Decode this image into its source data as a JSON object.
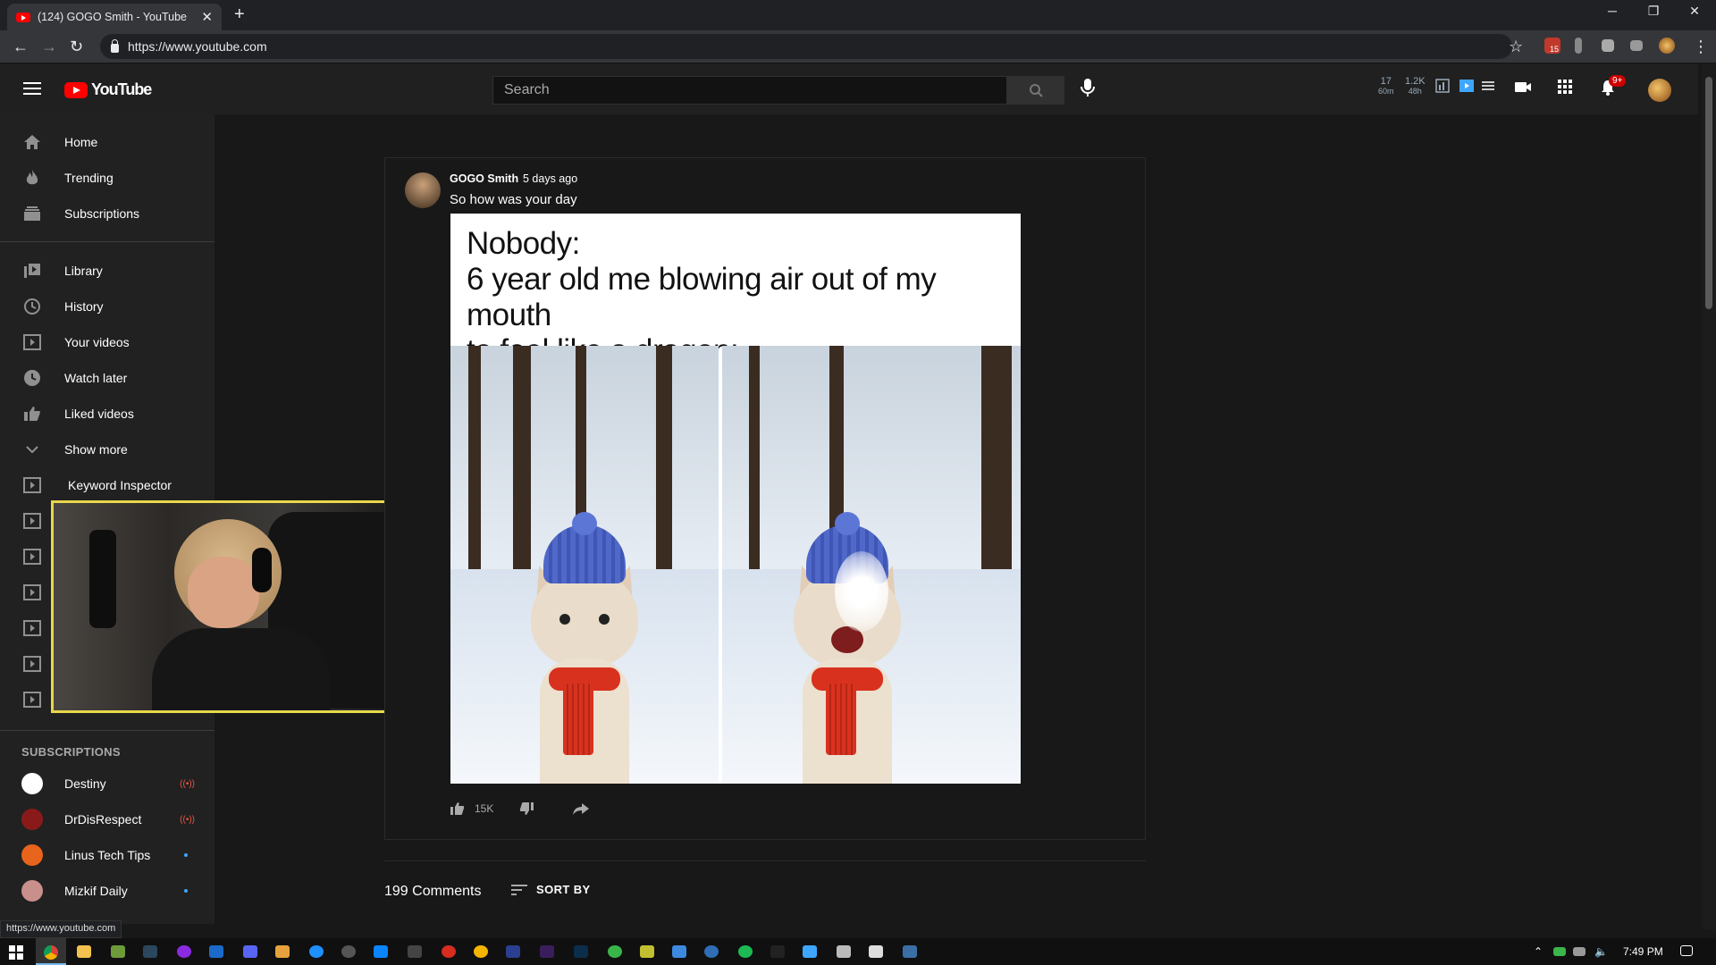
{
  "browser": {
    "tab_title": "(124) GOGO Smith - YouTube",
    "tab_close": "✕",
    "new_tab": "+",
    "url": "https://www.youtube.com",
    "status_url": "https://www.youtube.com",
    "extension_badge": "15"
  },
  "header": {
    "logo_text": "YouTube",
    "search_placeholder": "Search",
    "stats": [
      {
        "value": "17",
        "sub": "60m"
      },
      {
        "value": "1.2K",
        "sub": "48h"
      }
    ],
    "notification_badge": "9+"
  },
  "sidebar": {
    "main_items": [
      {
        "label": "Home",
        "icon": "home-icon"
      },
      {
        "label": "Trending",
        "icon": "fire-icon"
      },
      {
        "label": "Subscriptions",
        "icon": "subscriptions-icon"
      }
    ],
    "library_items": [
      {
        "label": "Library",
        "icon": "library-icon"
      },
      {
        "label": "History",
        "icon": "history-icon"
      },
      {
        "label": "Your videos",
        "icon": "your-videos-icon"
      },
      {
        "label": "Watch later",
        "icon": "clock-icon"
      },
      {
        "label": "Liked videos",
        "icon": "thumb-up-icon"
      },
      {
        "label": "Show more",
        "icon": "chevron-down-icon"
      },
      {
        "label": "Keyword Inspector",
        "icon": "playlist-icon"
      }
    ],
    "subscriptions_heading": "SUBSCRIPTIONS",
    "subscriptions": [
      {
        "name": "Destiny",
        "status": "live",
        "color": "#ffffff"
      },
      {
        "name": "DrDisRespect",
        "status": "live",
        "color": "#8a1a1a"
      },
      {
        "name": "Linus Tech Tips",
        "status": "new",
        "color": "#e8641c"
      },
      {
        "name": "Mizkif Daily",
        "status": "new",
        "color": "#c98f8a"
      }
    ]
  },
  "post": {
    "author": "GOGO Smith",
    "time": "5 days ago",
    "text": "So how was your day",
    "meme_caption_lines": [
      "Nobody:",
      "6 year old me blowing air out of my mouth",
      "to feel like a dragon:"
    ],
    "like_count": "15K"
  },
  "comments": {
    "count_label": "199 Comments",
    "sort_label": "SORT BY"
  },
  "taskbar": {
    "time": "7:49 PM"
  },
  "colors": {
    "brand": "#ff0000",
    "bg": "#181818",
    "sidebar": "#212121",
    "webcam_border": "#e8d84a"
  }
}
